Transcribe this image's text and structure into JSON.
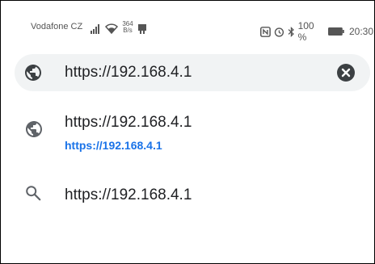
{
  "status_bar": {
    "carrier": "Vodafone CZ",
    "speed_value": "364",
    "speed_unit": "B/s",
    "battery": "100 %",
    "time": "20:30"
  },
  "omnibox": {
    "value": "https://192.168.4.1",
    "left_icon": "globe-icon",
    "clear_icon": "close-circle-icon"
  },
  "suggestions": [
    {
      "icon": "globe-icon",
      "title": "https://192.168.4.1",
      "url": "https://192.168.4.1"
    },
    {
      "icon": "search-icon",
      "title": "https://192.168.4.1"
    }
  ],
  "colors": {
    "link_blue": "#1a73e8",
    "omnibox_bg": "#f1f3f4",
    "icon_gray": "#5f6368",
    "icon_dark": "#3c4043"
  }
}
